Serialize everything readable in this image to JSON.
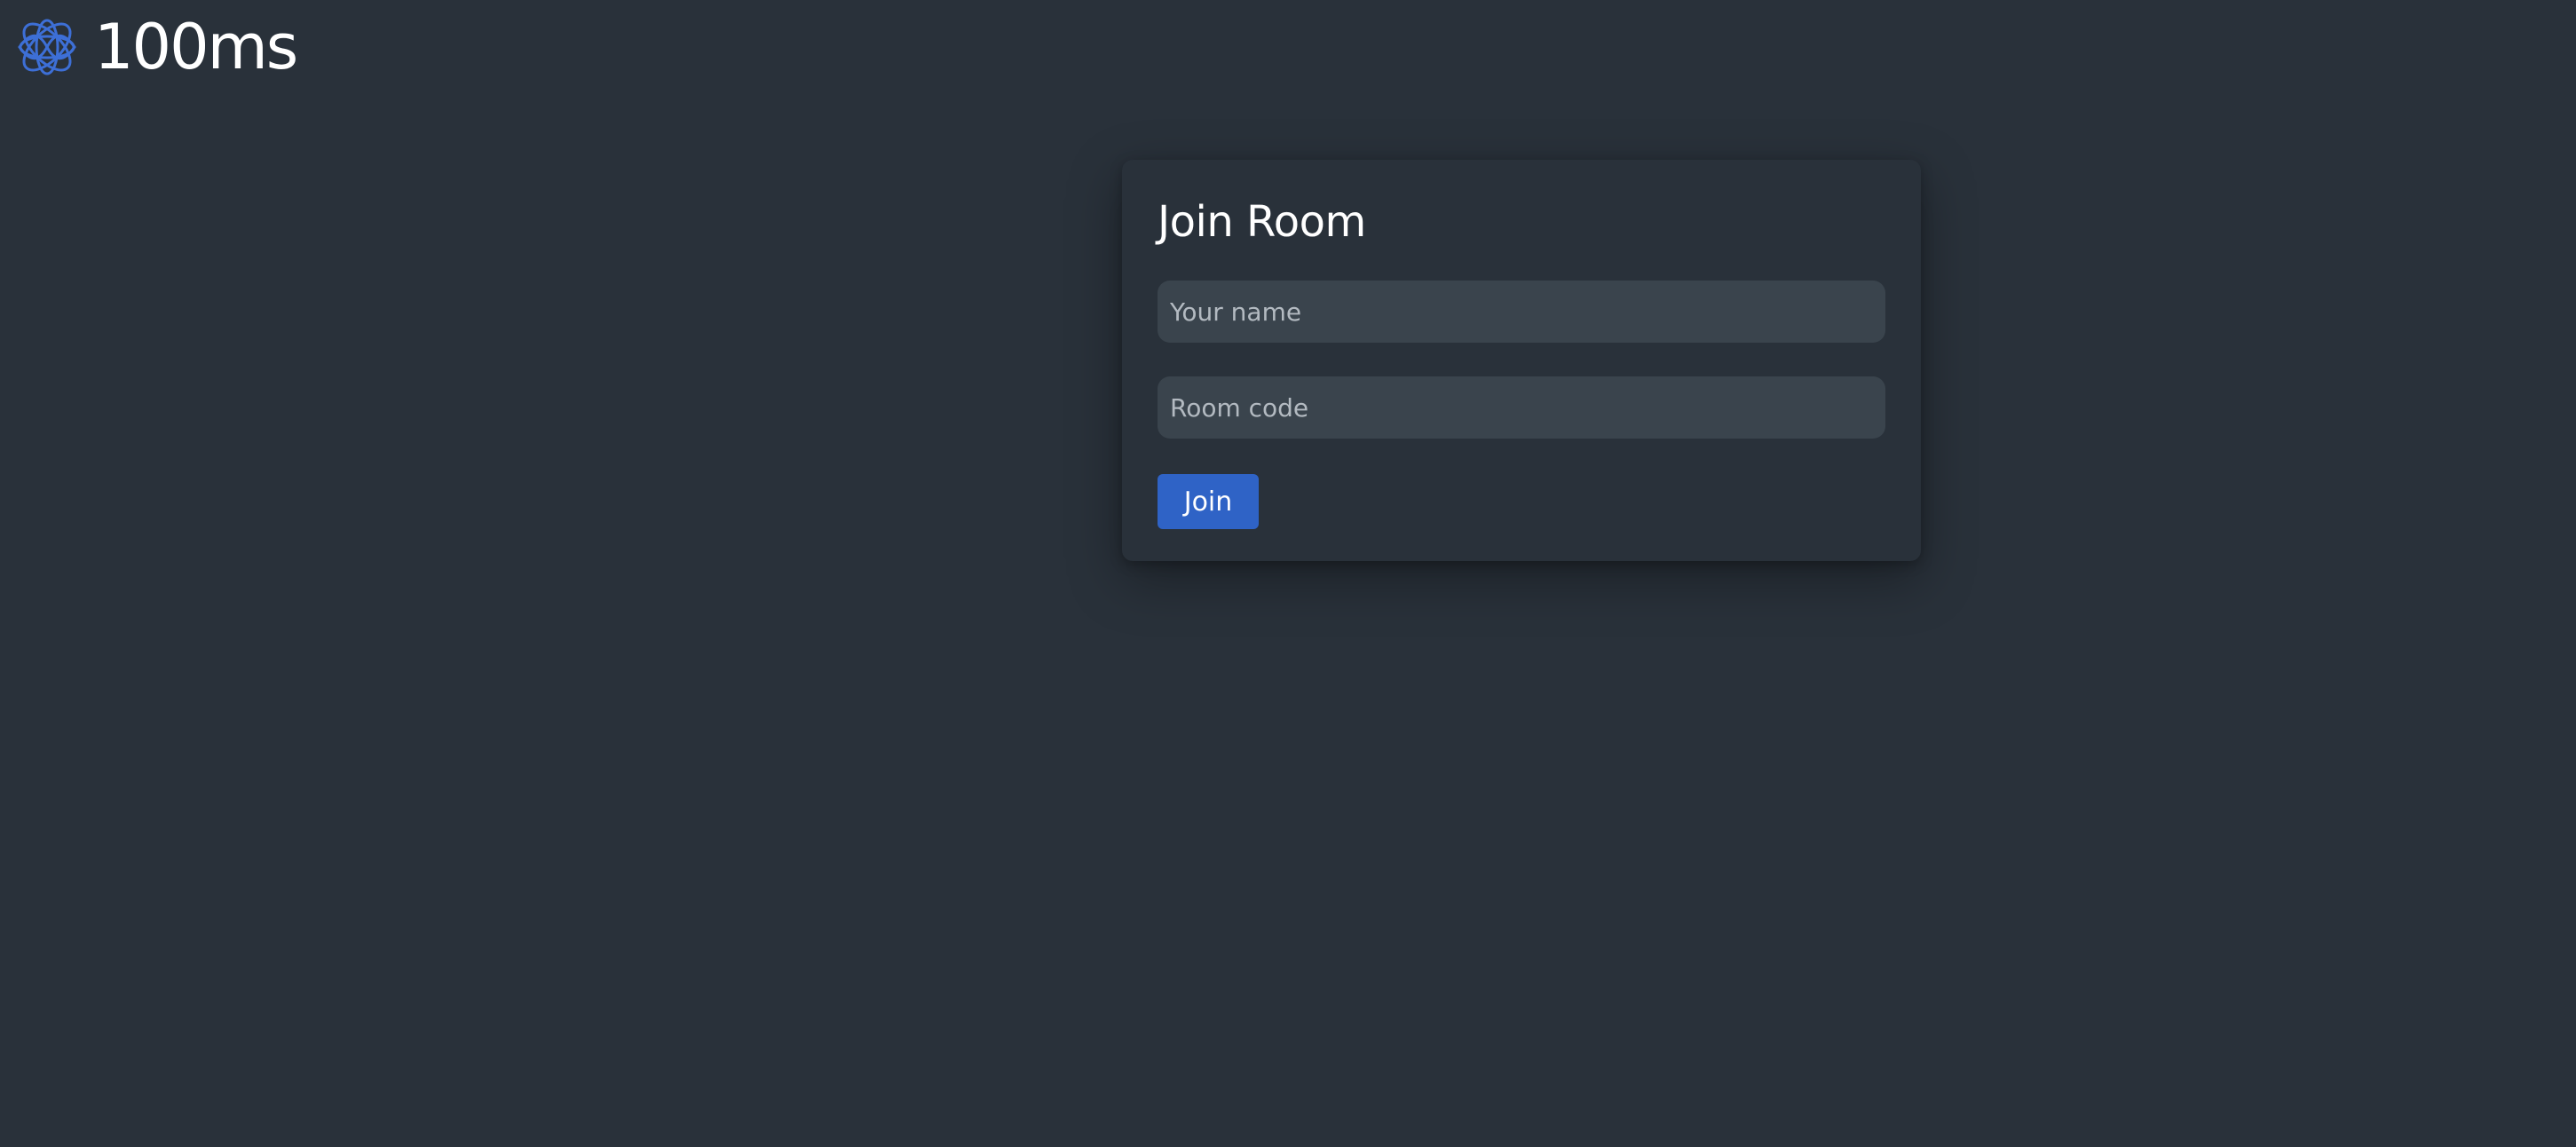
{
  "header": {
    "logo_icon": "infinity-knot-logo-icon",
    "brand_name": "100ms"
  },
  "join_form": {
    "title": "Join Room",
    "name_input": {
      "value": "",
      "placeholder": "Your name"
    },
    "room_input": {
      "value": "",
      "placeholder": "Room code"
    },
    "join_label": "Join"
  },
  "colors": {
    "background": "#29313a",
    "input_background": "#3a444d",
    "accent": "#2f63c6",
    "logo": "#3d6fd6",
    "text": "#ffffff",
    "placeholder": "#b3bac1"
  }
}
